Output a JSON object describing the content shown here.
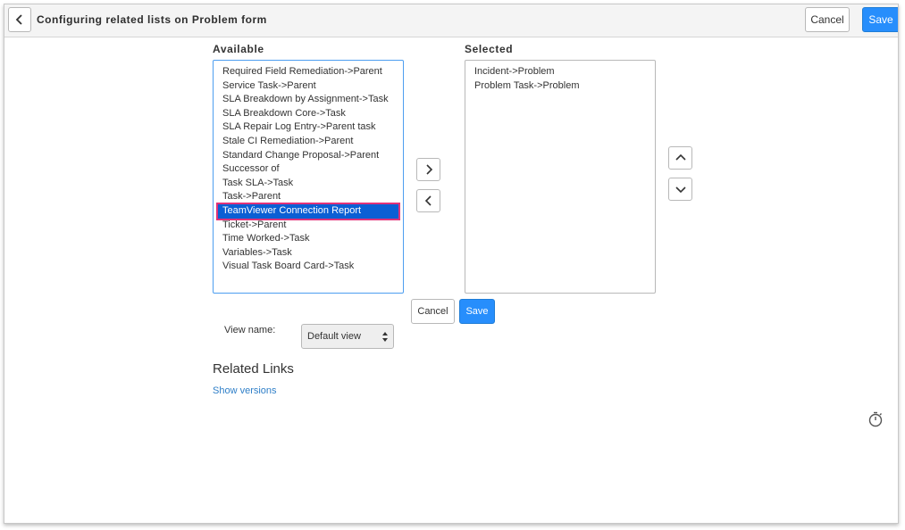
{
  "header": {
    "title": "Configuring related lists on Problem form",
    "cancel_label": "Cancel",
    "save_label": "Save"
  },
  "available": {
    "label": "Available",
    "items": [
      "Required Field Remediation->Parent",
      "Service Task->Parent",
      "SLA Breakdown by Assignment->Task",
      "SLA Breakdown Core->Task",
      "SLA Repair Log Entry->Parent task",
      "Stale CI Remediation->Parent",
      "Standard Change Proposal->Parent",
      "Successor of",
      "Task SLA->Task",
      "Task->Parent",
      "TeamViewer Connection Report",
      "Ticket->Parent",
      "Time Worked->Task",
      "Variables->Task",
      "Visual Task Board Card->Task"
    ],
    "selected_item": "TeamViewer Connection Report"
  },
  "selected": {
    "label": "Selected",
    "items": [
      "Incident->Problem",
      "Problem Task->Problem"
    ]
  },
  "form_actions": {
    "cancel_label": "Cancel",
    "save_label": "Save"
  },
  "view": {
    "label": "View name:",
    "value": "Default view"
  },
  "related_links": {
    "title": "Related Links",
    "link_label": "Show versions"
  },
  "colors": {
    "accent": "#278efc",
    "selection": "#0b5fd4",
    "highlight_outline": "#e0327a",
    "link": "#2f7fc8"
  },
  "icons": {
    "back": "chevron-left-icon",
    "add": "chevron-right-icon",
    "remove": "chevron-left-icon",
    "move_up": "chevron-up-icon",
    "move_down": "chevron-down-icon",
    "select_arrows": "sort-arrows-icon",
    "timer": "stopwatch-icon"
  }
}
